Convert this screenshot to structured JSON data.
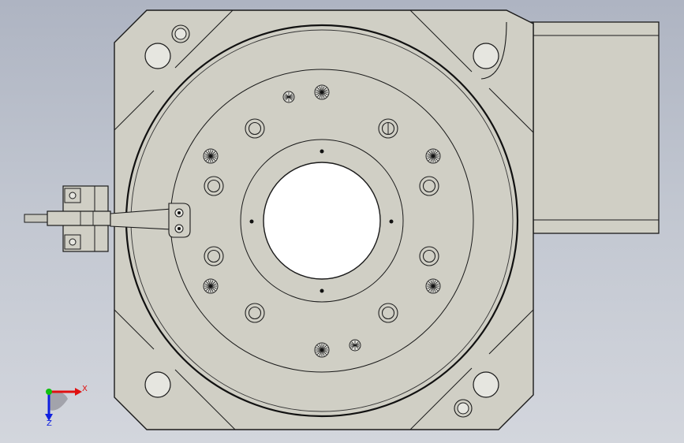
{
  "view": {
    "background_top": "#aeb4c2",
    "background_bottom": "#d3d6dd",
    "part_fill": "#d0cfc5",
    "outline": "#1a1a1a"
  },
  "model": {
    "type": "rotary-indexing-table",
    "parts": [
      "square-base-plate",
      "rotary-table",
      "center-bore",
      "motor-housing",
      "proximity-sensor",
      "sensor-bracket"
    ]
  },
  "triad": {
    "x_label": "X",
    "z_label": "Z",
    "x_color": "#e01010",
    "y_color": "#10c010",
    "z_color": "#1020e0"
  }
}
